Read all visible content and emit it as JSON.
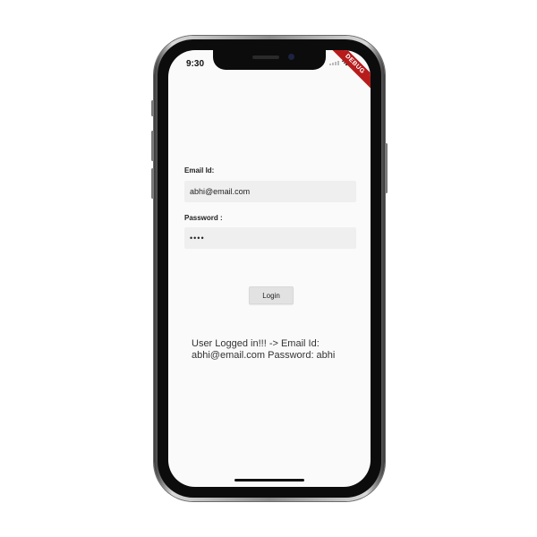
{
  "status_bar": {
    "time": "9:30",
    "debug_banner": "DEBUG"
  },
  "form": {
    "email_label": "Email Id:",
    "email_value": "abhi@email.com",
    "password_label": "Password :",
    "password_value": "abhi",
    "login_label": "Login"
  },
  "result": {
    "message": "User Logged in!!! ->  Email Id: abhi@email.com  Password: abhi"
  }
}
